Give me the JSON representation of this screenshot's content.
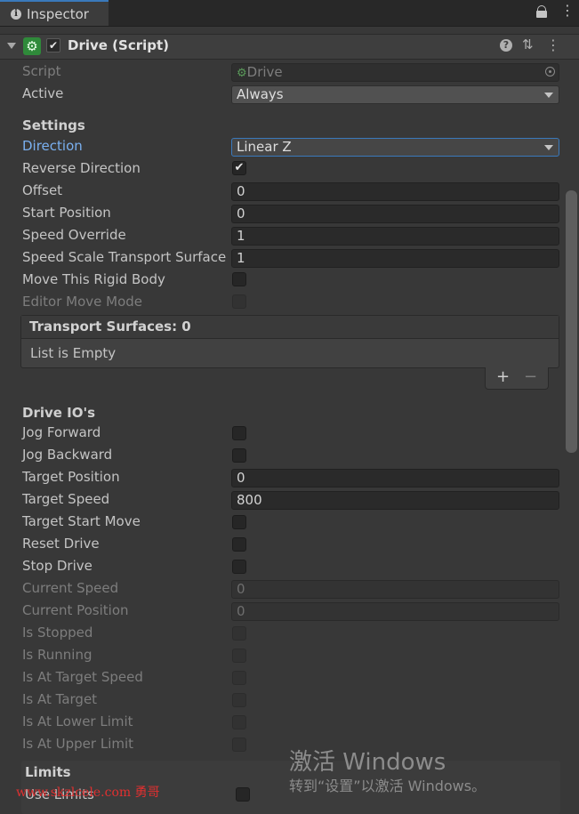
{
  "tab": {
    "icon": "info-icon",
    "label": "Inspector"
  },
  "window_controls": {
    "lock": "lock-icon",
    "menu": "kebab-menu-icon"
  },
  "component": {
    "icon": "gear-icon",
    "enabled": true,
    "title": "Drive (Script)",
    "help_icon": "help-icon",
    "preset_icon": "presets-icon",
    "menu_icon": "kebab-menu-icon"
  },
  "script_row": {
    "label": "Script",
    "value": "Drive"
  },
  "active_row": {
    "label": "Active",
    "value": "Always"
  },
  "settings": {
    "heading": "Settings",
    "direction": {
      "label": "Direction",
      "value": "Linear Z"
    },
    "reverse_direction": {
      "label": "Reverse Direction",
      "checked": true
    },
    "offset": {
      "label": "Offset",
      "value": "0"
    },
    "start_position": {
      "label": "Start Position",
      "value": "0"
    },
    "speed_override": {
      "label": "Speed Override",
      "value": "1"
    },
    "speed_scale": {
      "label": "Speed Scale Transport Surface",
      "value": "1"
    },
    "move_rigid_body": {
      "label": "Move This Rigid Body",
      "checked": false
    },
    "editor_move_mode": {
      "label": "Editor Move Mode",
      "checked": false
    }
  },
  "transport_surfaces": {
    "title": "Transport Surfaces: 0",
    "empty_text": "List is Empty",
    "add": "+",
    "remove": "−"
  },
  "drive_ios": {
    "heading": "Drive IO's",
    "jog_forward": "Jog Forward",
    "jog_backward": "Jog Backward",
    "target_position": {
      "label": "Target Position",
      "value": "0"
    },
    "target_speed": {
      "label": "Target Speed",
      "value": "800"
    },
    "target_start_move": "Target Start Move",
    "reset_drive": "Reset Drive",
    "stop_drive": "Stop Drive",
    "current_speed": {
      "label": "Current Speed",
      "value": "0"
    },
    "current_position": {
      "label": "Current Position",
      "value": "0"
    },
    "is_stopped": "Is Stopped",
    "is_running": "Is Running",
    "is_at_target_speed": "Is At Target Speed",
    "is_at_target": "Is At Target",
    "is_at_lower_limit": "Is At Lower Limit",
    "is_at_upper_limit": "Is At Upper Limit"
  },
  "limits": {
    "heading": "Limits",
    "use_limits": "Use Limits"
  },
  "watermark": {
    "activate_title": "激活 Windows",
    "activate_sub": "转到“设置”以激活 Windows。",
    "site": "www.skzlcele.com 勇哥"
  },
  "colors": {
    "accent": "#3a79bb",
    "component_icon": "#2f8a3a",
    "background": "#383838"
  }
}
